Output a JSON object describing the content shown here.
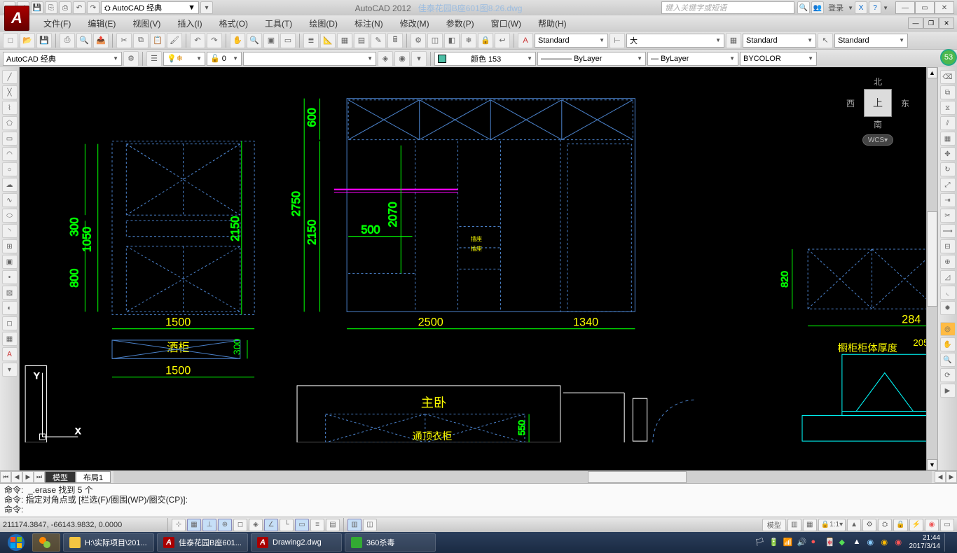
{
  "app": {
    "name": "AutoCAD 2012",
    "file": "佳泰花园B座601图8.26.dwg"
  },
  "qat": {
    "workspace_label": "AutoCAD 经典"
  },
  "search_placeholder": "键入关键字或短语",
  "login_label": "登录",
  "menu": {
    "file": "文件(F)",
    "edit": "编辑(E)",
    "view": "视图(V)",
    "insert": "插入(I)",
    "format": "格式(O)",
    "tool": "工具(T)",
    "draw": "绘图(D)",
    "dimension": "标注(N)",
    "modify": "修改(M)",
    "params": "参数(P)",
    "window": "窗口(W)",
    "help": "帮助(H)"
  },
  "toolbar2": {
    "workspace": "AutoCAD 经典",
    "layerstate": "0",
    "style1": "Standard",
    "dimstyle": "大",
    "tablestyle": "Standard",
    "mleader": "Standard"
  },
  "props": {
    "color_label": "颜色 153",
    "linetype": "ByLayer",
    "lineweight": "ByLayer",
    "plotstyle": "BYCOLOR"
  },
  "drawing": {
    "dims": {
      "d1050": "1050",
      "d300": "300",
      "d800": "800",
      "d1500a": "1500",
      "d1500b": "1500",
      "d300b": "300",
      "d2150": "2150",
      "d2750": "2750",
      "d600": "600",
      "d2150b": "2150",
      "d500": "500",
      "d2070": "2070",
      "d2500": "2500",
      "d1340": "1340",
      "d820": "820",
      "d284": "284",
      "d205": "205",
      "d550": "550"
    },
    "labels": {
      "wine_cabinet": "酒柜",
      "master_bed": "主卧",
      "top_wardrobe": "通顶衣柜",
      "cabinet_thickness": "橱柜柜体厚度"
    },
    "viewcube": {
      "n": "北",
      "s": "南",
      "e": "东",
      "w": "西",
      "top": "上",
      "wcs": "WCS"
    },
    "badge": "53"
  },
  "tabs": {
    "model": "模型",
    "layout1": "布局1"
  },
  "cmd": {
    "l1": "命令:  _.erase 找到 5 个",
    "l2": "命令: 指定对角点或 [栏选(F)/圈围(WP)/圈交(CP)]:",
    "l3": "命令:"
  },
  "status": {
    "coords": "211174.3847, -66143.9832, 0.0000",
    "model": "模型",
    "scale": "1:1"
  },
  "taskbar": {
    "item1": "H:\\实际项目\\201...",
    "item2": "佳泰花园B座601...",
    "item3": "Drawing2.dwg",
    "item4": "360杀毒",
    "time": "21:44",
    "date": "2017/3/14"
  }
}
